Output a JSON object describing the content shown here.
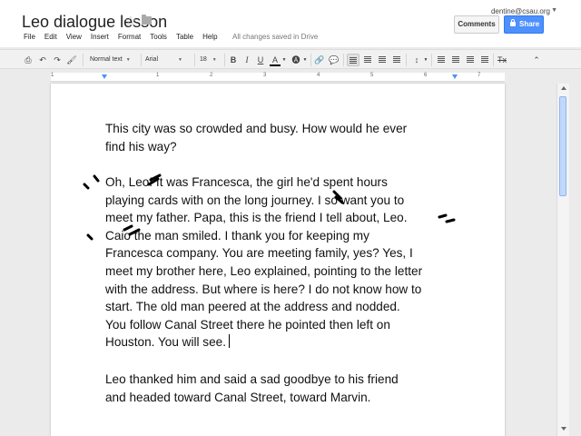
{
  "header": {
    "doc_title": "Leo dialogue lesson",
    "user_email": "dentine@csau.org",
    "comments_label": "Comments",
    "share_label": "Share",
    "save_status": "All changes saved in Drive"
  },
  "menu": [
    "File",
    "Edit",
    "View",
    "Insert",
    "Format",
    "Tools",
    "Table",
    "Help"
  ],
  "toolbar": {
    "style_value": "Normal text",
    "font_value": "Arial",
    "size_value": "18",
    "bold": "B",
    "italic": "I",
    "underline": "U",
    "text_color": "A",
    "clear_format": "Tx"
  },
  "ruler": {
    "numbers": [
      "1",
      "1",
      "2",
      "3",
      "4",
      "5",
      "6",
      "7"
    ]
  },
  "document": {
    "paragraphs": [
      [
        "This city was so crowded and busy. How would he ever",
        "find his way?"
      ],
      [
        "Oh, Leo! It was Francesca, the girl he'd spent hours",
        "playing cards with on the long journey. I so want you to",
        "meet my father. Papa, this is the friend I tell about, Leo.",
        "Caio the man smiled. I thank you for keeping my",
        "Francesca company. You are meeting family, yes? Yes, I",
        "meet my brother here, Leo explained, pointing to the letter",
        "with the address. But where is here? I do not know how to",
        "start. The old man peered at the address and nodded.",
        "You follow Canal Street there he pointed then left on",
        "Houston. You will see."
      ],
      [
        "Leo thanked him and said a sad goodbye to his friend",
        "and headed toward Canal Street, toward Marvin."
      ]
    ]
  },
  "colors": {
    "accent_blue": "#4d90fe",
    "toolbar_bg": "#f1f1f1",
    "canvas_bg": "#ebebeb"
  }
}
